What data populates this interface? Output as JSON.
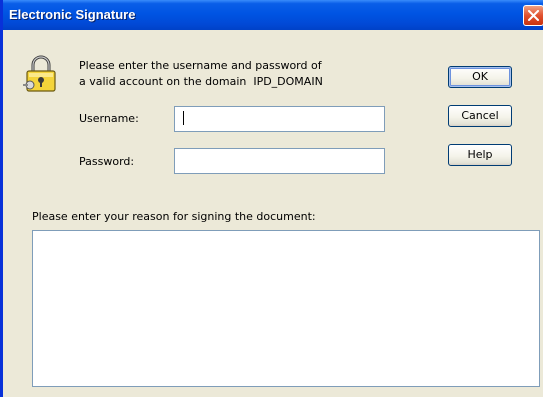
{
  "window": {
    "title": "Electronic Signature",
    "close_icon": "close-icon"
  },
  "prompt": {
    "line1": "Please enter the username and password of",
    "line2": "a valid account on the domain  IPD_DOMAIN",
    "icon": "lock-key-icon"
  },
  "form": {
    "username_label": "Username:",
    "username_value": "",
    "password_label": "Password:",
    "password_value": ""
  },
  "buttons": {
    "ok": "OK",
    "cancel": "Cancel",
    "help": "Help"
  },
  "reason": {
    "label": "Please enter your reason for signing the document:",
    "value": ""
  },
  "colors": {
    "titlebar": "#0054e3",
    "dialog_bg": "#ece9d8",
    "close_button": "#e1512f",
    "field_border": "#7f9db9"
  }
}
